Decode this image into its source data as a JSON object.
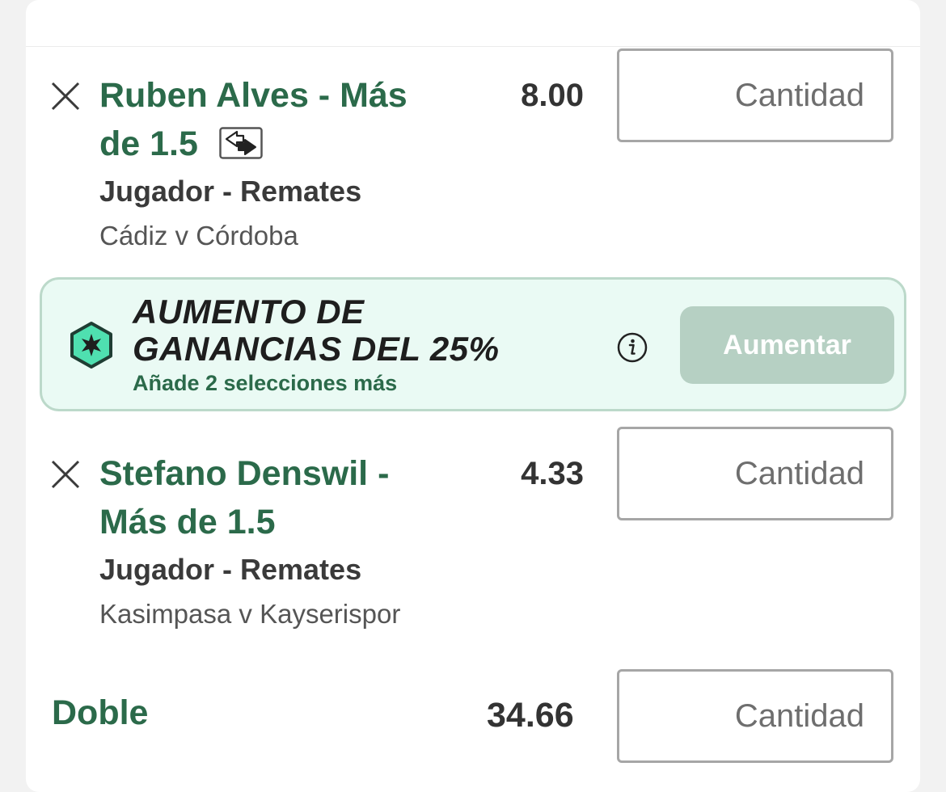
{
  "selections": [
    {
      "title": "Ruben Alves - Más de 1.5",
      "title_line1": "Ruben Alves - Más",
      "title_line2": "de 1.5",
      "odds": "8.00",
      "market": "Jugador - Remates",
      "event": "Cádiz v Córdoba",
      "stake_placeholder": "Cantidad",
      "icons": [
        "close-icon",
        "swap-icon"
      ]
    },
    {
      "title": "Stefano Denswil - Más de 1.5",
      "title_line1": "Stefano Denswil -",
      "title_line2": "Más de 1.5",
      "odds": "4.33",
      "market": "Jugador - Remates",
      "event": "Kasimpasa v Kayserispor",
      "stake_placeholder": "Cantidad",
      "icons": [
        "close-icon"
      ]
    }
  ],
  "promo": {
    "title_line1": "AUMENTO DE",
    "title_line2": "GANANCIAS DEL 25%",
    "subtitle": "Añade 2 selecciones más",
    "button_label": "Aumentar",
    "icons": [
      "boost-hexagon-icon",
      "info-icon"
    ]
  },
  "combo": {
    "label": "Doble",
    "odds": "34.66",
    "stake_placeholder": "Cantidad"
  },
  "colors": {
    "brand_green": "#2b6a4a",
    "promo_bg": "#eafaf4",
    "promo_border": "#bcd9ca",
    "button_disabled": "#b6d0c3",
    "hex_fill": "#4fe0b0"
  }
}
